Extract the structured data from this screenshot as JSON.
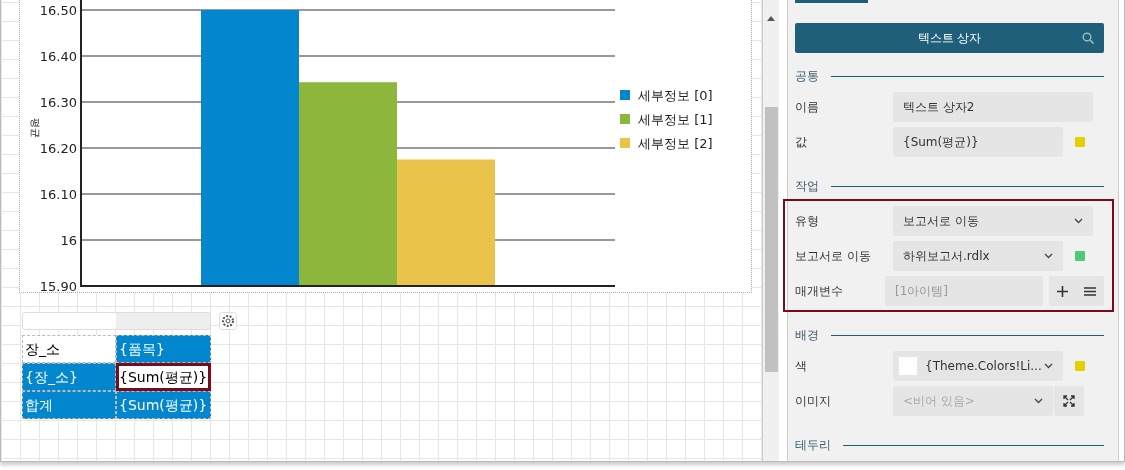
{
  "chart": {
    "chart_data": {
      "type": "bar",
      "ylabel": "평균",
      "categories": [
        null
      ],
      "grid": true,
      "legend": true,
      "series": [
        {
          "name": "세부정보 [0]",
          "color": "#0286ce",
          "values": [
            16.5
          ]
        },
        {
          "name": "세부정보 [1]",
          "color": "#8cb63c",
          "values": [
            16.343
          ]
        },
        {
          "name": "세부정보 [2]",
          "color": "#e9c34a",
          "values": [
            16.175
          ]
        }
      ],
      "ylim": [
        15.9,
        16.5
      ],
      "yticks": [
        {
          "value": 15.9,
          "label": "15.90"
        },
        {
          "value": 16,
          "label": "16"
        },
        {
          "value": 16.1,
          "label": "16.10"
        },
        {
          "value": 16.2,
          "label": "16.20"
        },
        {
          "value": 16.3,
          "label": "16.30"
        },
        {
          "value": 16.4,
          "label": "16.40"
        },
        {
          "value": 16.5,
          "label": "16.50"
        }
      ]
    }
  },
  "table": {
    "rows": [
      [
        {
          "text": "장_소",
          "selected": false,
          "focused": false
        },
        {
          "text": "{품목}",
          "selected": true,
          "focused": false
        }
      ],
      [
        {
          "text": "{장_소}",
          "selected": true,
          "focused": false
        },
        {
          "text": "{Sum(평균)}",
          "selected": false,
          "focused": true
        }
      ],
      [
        {
          "text": "합계",
          "selected": true,
          "focused": false
        },
        {
          "text": "{Sum(평균)}",
          "selected": true,
          "focused": false
        }
      ]
    ]
  },
  "panel": {
    "title": "텍스트 상자",
    "sections": [
      {
        "heading": "공통",
        "highlighted": false,
        "rows": [
          {
            "label": "이름",
            "kind": "text",
            "value": "텍스트 상자2"
          },
          {
            "label": "값",
            "kind": "text",
            "value": "{Sum(평균)}",
            "color": "#e5d100"
          }
        ]
      },
      {
        "heading": "작업",
        "highlighted": true,
        "rows": [
          {
            "label": "유형",
            "kind": "select",
            "value": "보고서로 이동"
          },
          {
            "label": "보고서로 이동",
            "kind": "select",
            "value": "하위보고서.rdlx",
            "color": "#4ec97a"
          },
          {
            "label": "매개변수",
            "kind": "list",
            "placeholder": "[1아이템]"
          }
        ]
      },
      {
        "heading": "배경",
        "highlighted": false,
        "rows": [
          {
            "label": "색",
            "kind": "color-select",
            "value": "{Theme.Colors!Li...",
            "color": "#e5d100"
          },
          {
            "label": "이미지",
            "kind": "select-expand",
            "placeholder": "<비어 있음>"
          }
        ]
      },
      {
        "heading": "테두리",
        "highlighted": false
      }
    ]
  }
}
